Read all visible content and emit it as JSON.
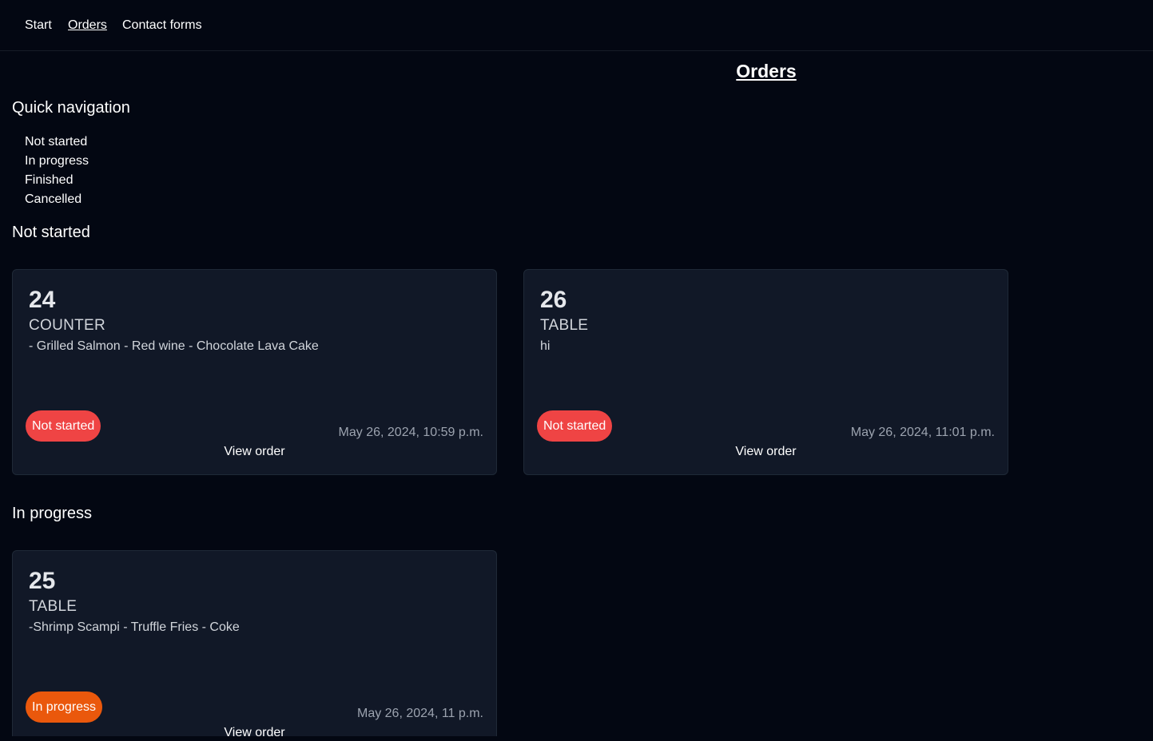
{
  "nav": {
    "items": [
      {
        "label": "Start"
      },
      {
        "label": "Orders"
      },
      {
        "label": "Contact forms"
      }
    ]
  },
  "page": {
    "title": "Orders"
  },
  "quick_nav": {
    "heading": "Quick navigation",
    "links": [
      {
        "label": "Not started"
      },
      {
        "label": "In progress"
      },
      {
        "label": "Finished"
      },
      {
        "label": "Cancelled"
      }
    ]
  },
  "sections": [
    {
      "heading": "Not started",
      "orders": [
        {
          "number": "24",
          "type": "COUNTER",
          "items": "- Grilled Salmon - Red wine - Chocolate Lava Cake",
          "status": "Not started",
          "date": "May 26, 2024, 10:59 p.m.",
          "view_label": "View order"
        },
        {
          "number": "26",
          "type": "TABLE",
          "items": "hi",
          "status": "Not started",
          "date": "May 26, 2024, 11:01 p.m.",
          "view_label": "View order"
        }
      ]
    },
    {
      "heading": "In progress",
      "orders": [
        {
          "number": "25",
          "type": "TABLE",
          "items": "-Shrimp Scampi - Truffle Fries - Coke",
          "status": "In progress",
          "date": "May 26, 2024, 11 p.m.",
          "view_label": "View order"
        }
      ]
    }
  ],
  "colors": {
    "background": "#030712",
    "card": "#111827",
    "not_started": "#ef4444",
    "in_progress": "#ea580c"
  }
}
